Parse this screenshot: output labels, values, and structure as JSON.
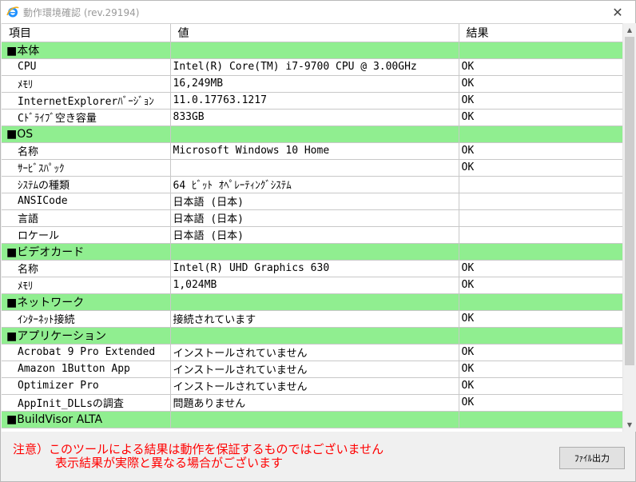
{
  "window": {
    "title": "動作環境確認 (rev.29194)"
  },
  "table": {
    "headers": [
      "項目",
      "値",
      "結果"
    ],
    "rows": [
      {
        "type": "section",
        "cells": [
          "■本体",
          "",
          ""
        ]
      },
      {
        "type": "item",
        "cells": [
          "CPU",
          "Intel(R) Core(TM) i7-9700 CPU @ 3.00GHz",
          "OK"
        ]
      },
      {
        "type": "item",
        "cells": [
          "ﾒﾓﾘ",
          "16,249MB",
          "OK"
        ]
      },
      {
        "type": "item",
        "cells": [
          "InternetExplorerﾊﾞｰｼﾞｮﾝ",
          "11.0.17763.1217",
          "OK"
        ]
      },
      {
        "type": "item",
        "cells": [
          "Cﾄﾞﾗｲﾌﾞ空き容量",
          "833GB",
          "OK"
        ]
      },
      {
        "type": "section",
        "cells": [
          "■OS",
          "",
          ""
        ]
      },
      {
        "type": "item",
        "cells": [
          "名称",
          "Microsoft Windows 10 Home",
          "OK"
        ]
      },
      {
        "type": "item",
        "cells": [
          "ｻｰﾋﾞｽﾊﾟｯｸ",
          "",
          "OK"
        ]
      },
      {
        "type": "item",
        "cells": [
          "ｼｽﾃﾑの種類",
          "64 ﾋﾞｯﾄ ｵﾍﾟﾚｰﾃｨﾝｸﾞｼｽﾃﾑ",
          ""
        ]
      },
      {
        "type": "item",
        "cells": [
          "ANSICode",
          "日本語 (日本)",
          ""
        ]
      },
      {
        "type": "item",
        "cells": [
          "言語",
          "日本語 (日本)",
          ""
        ]
      },
      {
        "type": "item",
        "cells": [
          "ロケール",
          "日本語 (日本)",
          ""
        ]
      },
      {
        "type": "section",
        "cells": [
          "■ビデオカード",
          "",
          ""
        ]
      },
      {
        "type": "item",
        "cells": [
          "名称",
          "Intel(R) UHD Graphics 630",
          "OK"
        ]
      },
      {
        "type": "item",
        "cells": [
          "ﾒﾓﾘ",
          "1,024MB",
          "OK"
        ]
      },
      {
        "type": "section",
        "cells": [
          "■ネットワーク",
          "",
          ""
        ]
      },
      {
        "type": "item",
        "cells": [
          "ｲﾝﾀｰﾈｯﾄ接続",
          "接続されています",
          "OK"
        ]
      },
      {
        "type": "section",
        "cells": [
          "■アプリケーション",
          "",
          ""
        ]
      },
      {
        "type": "item",
        "cells": [
          "Acrobat 9 Pro Extended",
          "インストールされていません",
          "OK"
        ]
      },
      {
        "type": "item",
        "cells": [
          "Amazon 1Button App",
          "インストールされていません",
          "OK"
        ]
      },
      {
        "type": "item",
        "cells": [
          "Optimizer Pro",
          "インストールされていません",
          "OK"
        ]
      },
      {
        "type": "item",
        "cells": [
          "AppInit_DLLsの調査",
          "問題ありません",
          "OK"
        ]
      },
      {
        "type": "section",
        "cells": [
          "■BuildVisor ALTA",
          "",
          ""
        ]
      }
    ]
  },
  "notice": {
    "line1": "注意）このツールによる結果は動作を保証するものではございません",
    "line2": "表示結果が実際と異なる場合がございます"
  },
  "buttons": {
    "file_output": "ﾌｧｲﾙ出力"
  },
  "icons": {
    "app": "ie-icon",
    "close": "close-icon"
  }
}
